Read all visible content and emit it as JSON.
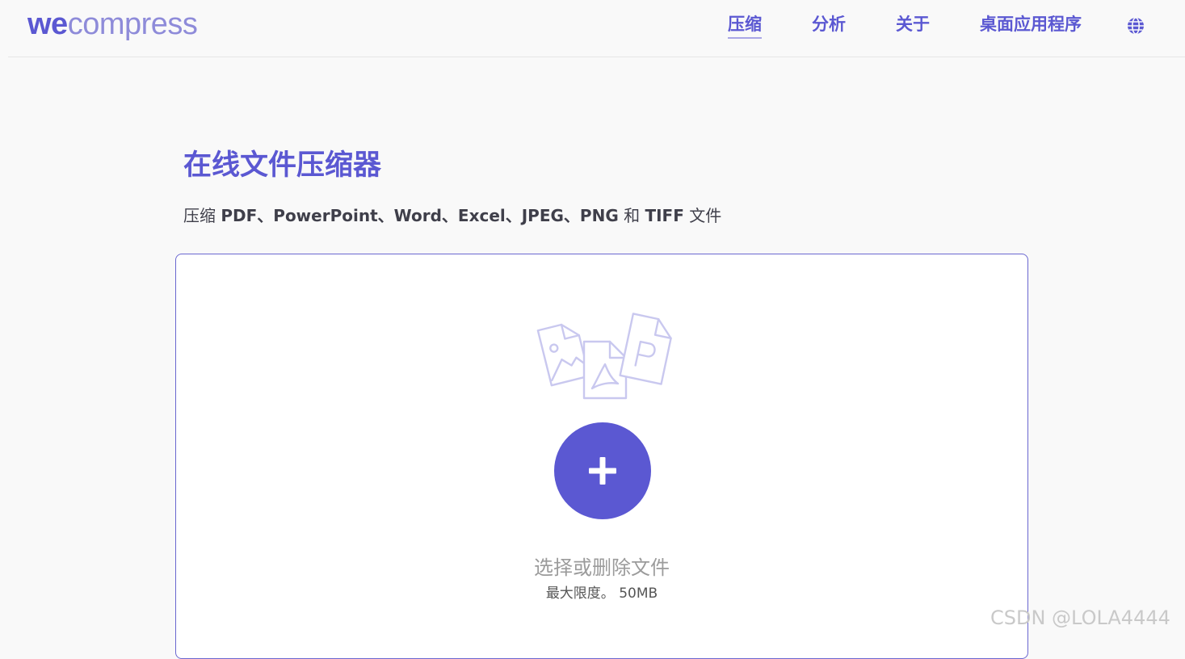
{
  "header": {
    "logo_we": "we",
    "logo_rest": "compress",
    "nav": [
      {
        "label": "压缩",
        "active": true
      },
      {
        "label": "分析",
        "active": false
      },
      {
        "label": "关于",
        "active": false
      },
      {
        "label": "桌面应用程序",
        "active": false
      }
    ],
    "language_icon": "globe-icon"
  },
  "main": {
    "title": "在线文件压缩器",
    "subtitle": {
      "prefix": "压缩 ",
      "formats": "PDF、PowerPoint、Word、Excel、JPEG、PNG",
      "connector": " 和 ",
      "last_format": "TIFF",
      "suffix": " 文件"
    }
  },
  "dropzone": {
    "illustration_icon": "file-types-illustration",
    "add_icon": "plus-icon",
    "select_text": "选择或删除文件",
    "limit_label": "最大限度。",
    "limit_value": "50MB"
  },
  "watermark": "CSDN @LOLA4444",
  "colors": {
    "accent": "#5b58d2",
    "accent_light": "#8e8bd9",
    "illustration": "#c9c8ef",
    "border": "#6a67d0",
    "background": "#f9f9f9"
  }
}
